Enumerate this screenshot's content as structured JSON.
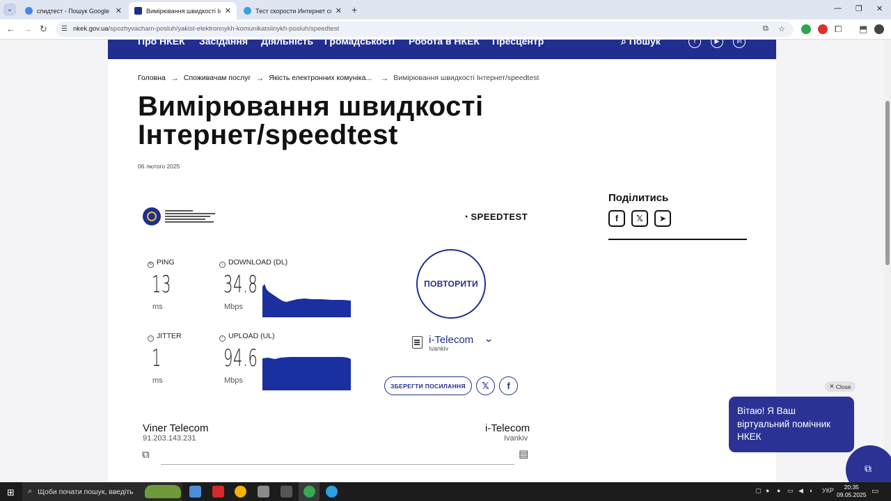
{
  "browser": {
    "tabs": [
      {
        "title": "спидтест - Пошук Google",
        "favicon_color": "#4285f4",
        "active": false
      },
      {
        "title": "Вимірювання швидкості Інтер",
        "favicon_color": "#1f2e8f",
        "active": true
      },
      {
        "title": "Тест скорости Интернет соед",
        "favicon_color": "#3aa0e0",
        "active": false
      }
    ],
    "new_tab": "+",
    "url_domain": "nkek.gov.ua",
    "url_path": "/spozhyvacham-posluh/yakist-elektronnykh-komunikatsiinykh-posluh/speedtest"
  },
  "site_nav": {
    "items": [
      "Про НКЕК",
      "Засідання",
      "Діяльність",
      "Громадськості",
      "Робота в НКЕК",
      "Пресцентр"
    ],
    "search_label": "Пошук"
  },
  "breadcrumb": {
    "home": "Головна",
    "level1": "Споживачам послуг",
    "level2": "Якість електронних комуніка...",
    "current": "Вимірювання швидкості Інтернет/speedtest"
  },
  "page": {
    "title": "Вимірювання швидкості Інтернет/speedtest",
    "date": "06 лютого 2025"
  },
  "speedtest": {
    "brand": "SPEEDTEST",
    "ping": {
      "label": "PING",
      "value": "13",
      "unit": "ms"
    },
    "jitter": {
      "label": "JITTER",
      "value": "1",
      "unit": "ms"
    },
    "download": {
      "label": "DOWNLOAD (DL)",
      "value": "34.8",
      "unit": "Mbps"
    },
    "upload": {
      "label": "UPLOAD (UL)",
      "value": "94.6",
      "unit": "Mbps"
    },
    "retry_label": "ПОВТОРИТИ",
    "server_name": "i-Telecom",
    "server_location": "Ivankiv",
    "save_link_label": "ЗБЕРЕГТИ ПОСИЛАННЯ",
    "client_isp": "Viner Telecom",
    "client_ip": "91.203.143.231",
    "server_isp": "i-Telecom",
    "server_city": "Ivankiv",
    "accent": "#1f2e8f"
  },
  "share": {
    "title": "Поділитись"
  },
  "chat": {
    "close_label": "Close",
    "message": "Вітаю! Я Ваш віртуальний помічник НКЕК"
  },
  "taskbar": {
    "search_placeholder": "Щоби почати пошук, введіть",
    "language": "УКР",
    "time": "20:35",
    "date": "09.05.2025"
  }
}
